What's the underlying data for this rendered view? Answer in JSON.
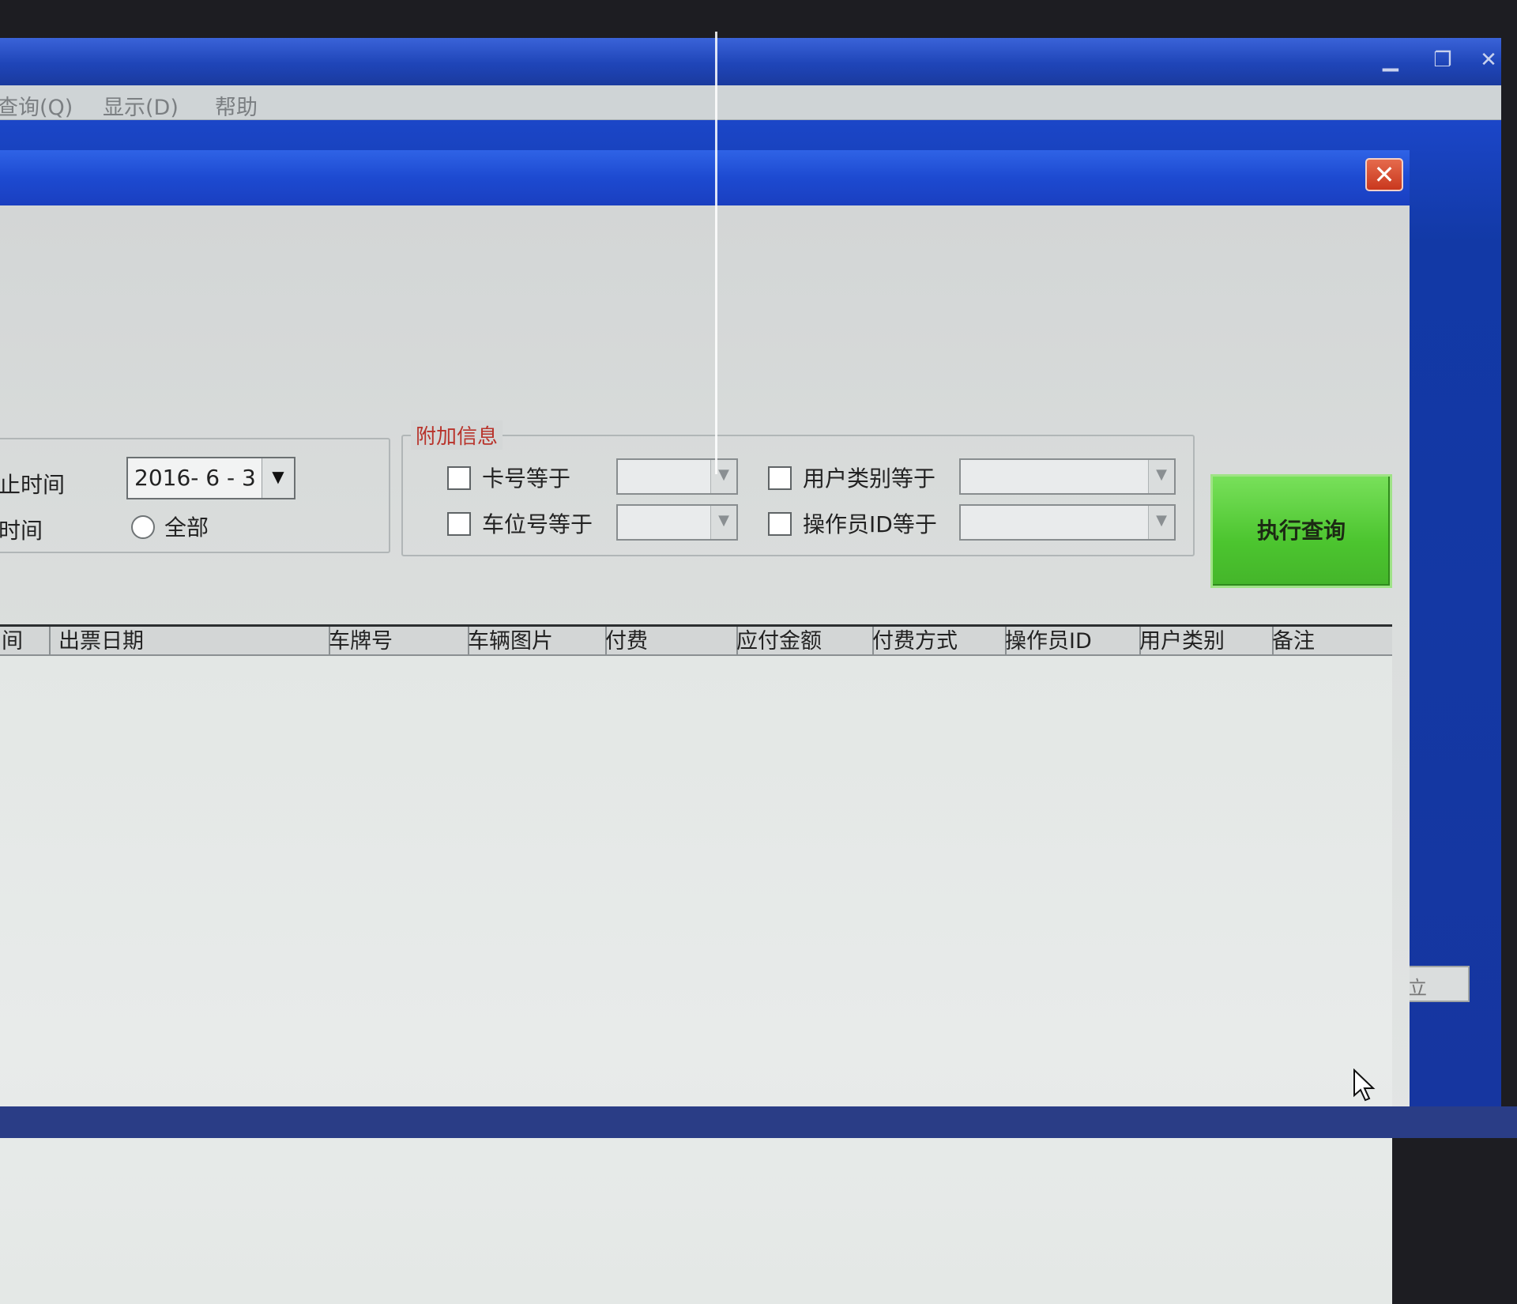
{
  "outer_window": {
    "controls": {
      "minimize": "▁",
      "restore": "❐",
      "close": "✕"
    },
    "menu": [
      "查询(Q)",
      "显示(D)",
      "帮助"
    ]
  },
  "dialog": {
    "close": "✕",
    "date_filter": {
      "end_time_label": "止时间",
      "end_date_value": "2016- 6 - 3",
      "time_label": "时间",
      "all_radio_label": "全部"
    },
    "extra_info": {
      "title": "附加信息",
      "card_no_label": "卡号等于",
      "space_no_label": "车位号等于",
      "user_type_label": "用户类别等于",
      "operator_id_label": "操作员ID等于"
    },
    "run_query_label": "执行查询",
    "list": {
      "columns": [
        "间",
        "出票日期",
        "车牌号",
        "车辆图片",
        "付费",
        "应付金额",
        "付费方式",
        "操作员ID",
        "用户类别",
        "备注"
      ],
      "rows": []
    }
  },
  "side_field_text": "立",
  "colors": {
    "title_blue": "#1f45b8",
    "run_green": "#4cc52f",
    "group_title_red": "#b8332b"
  }
}
